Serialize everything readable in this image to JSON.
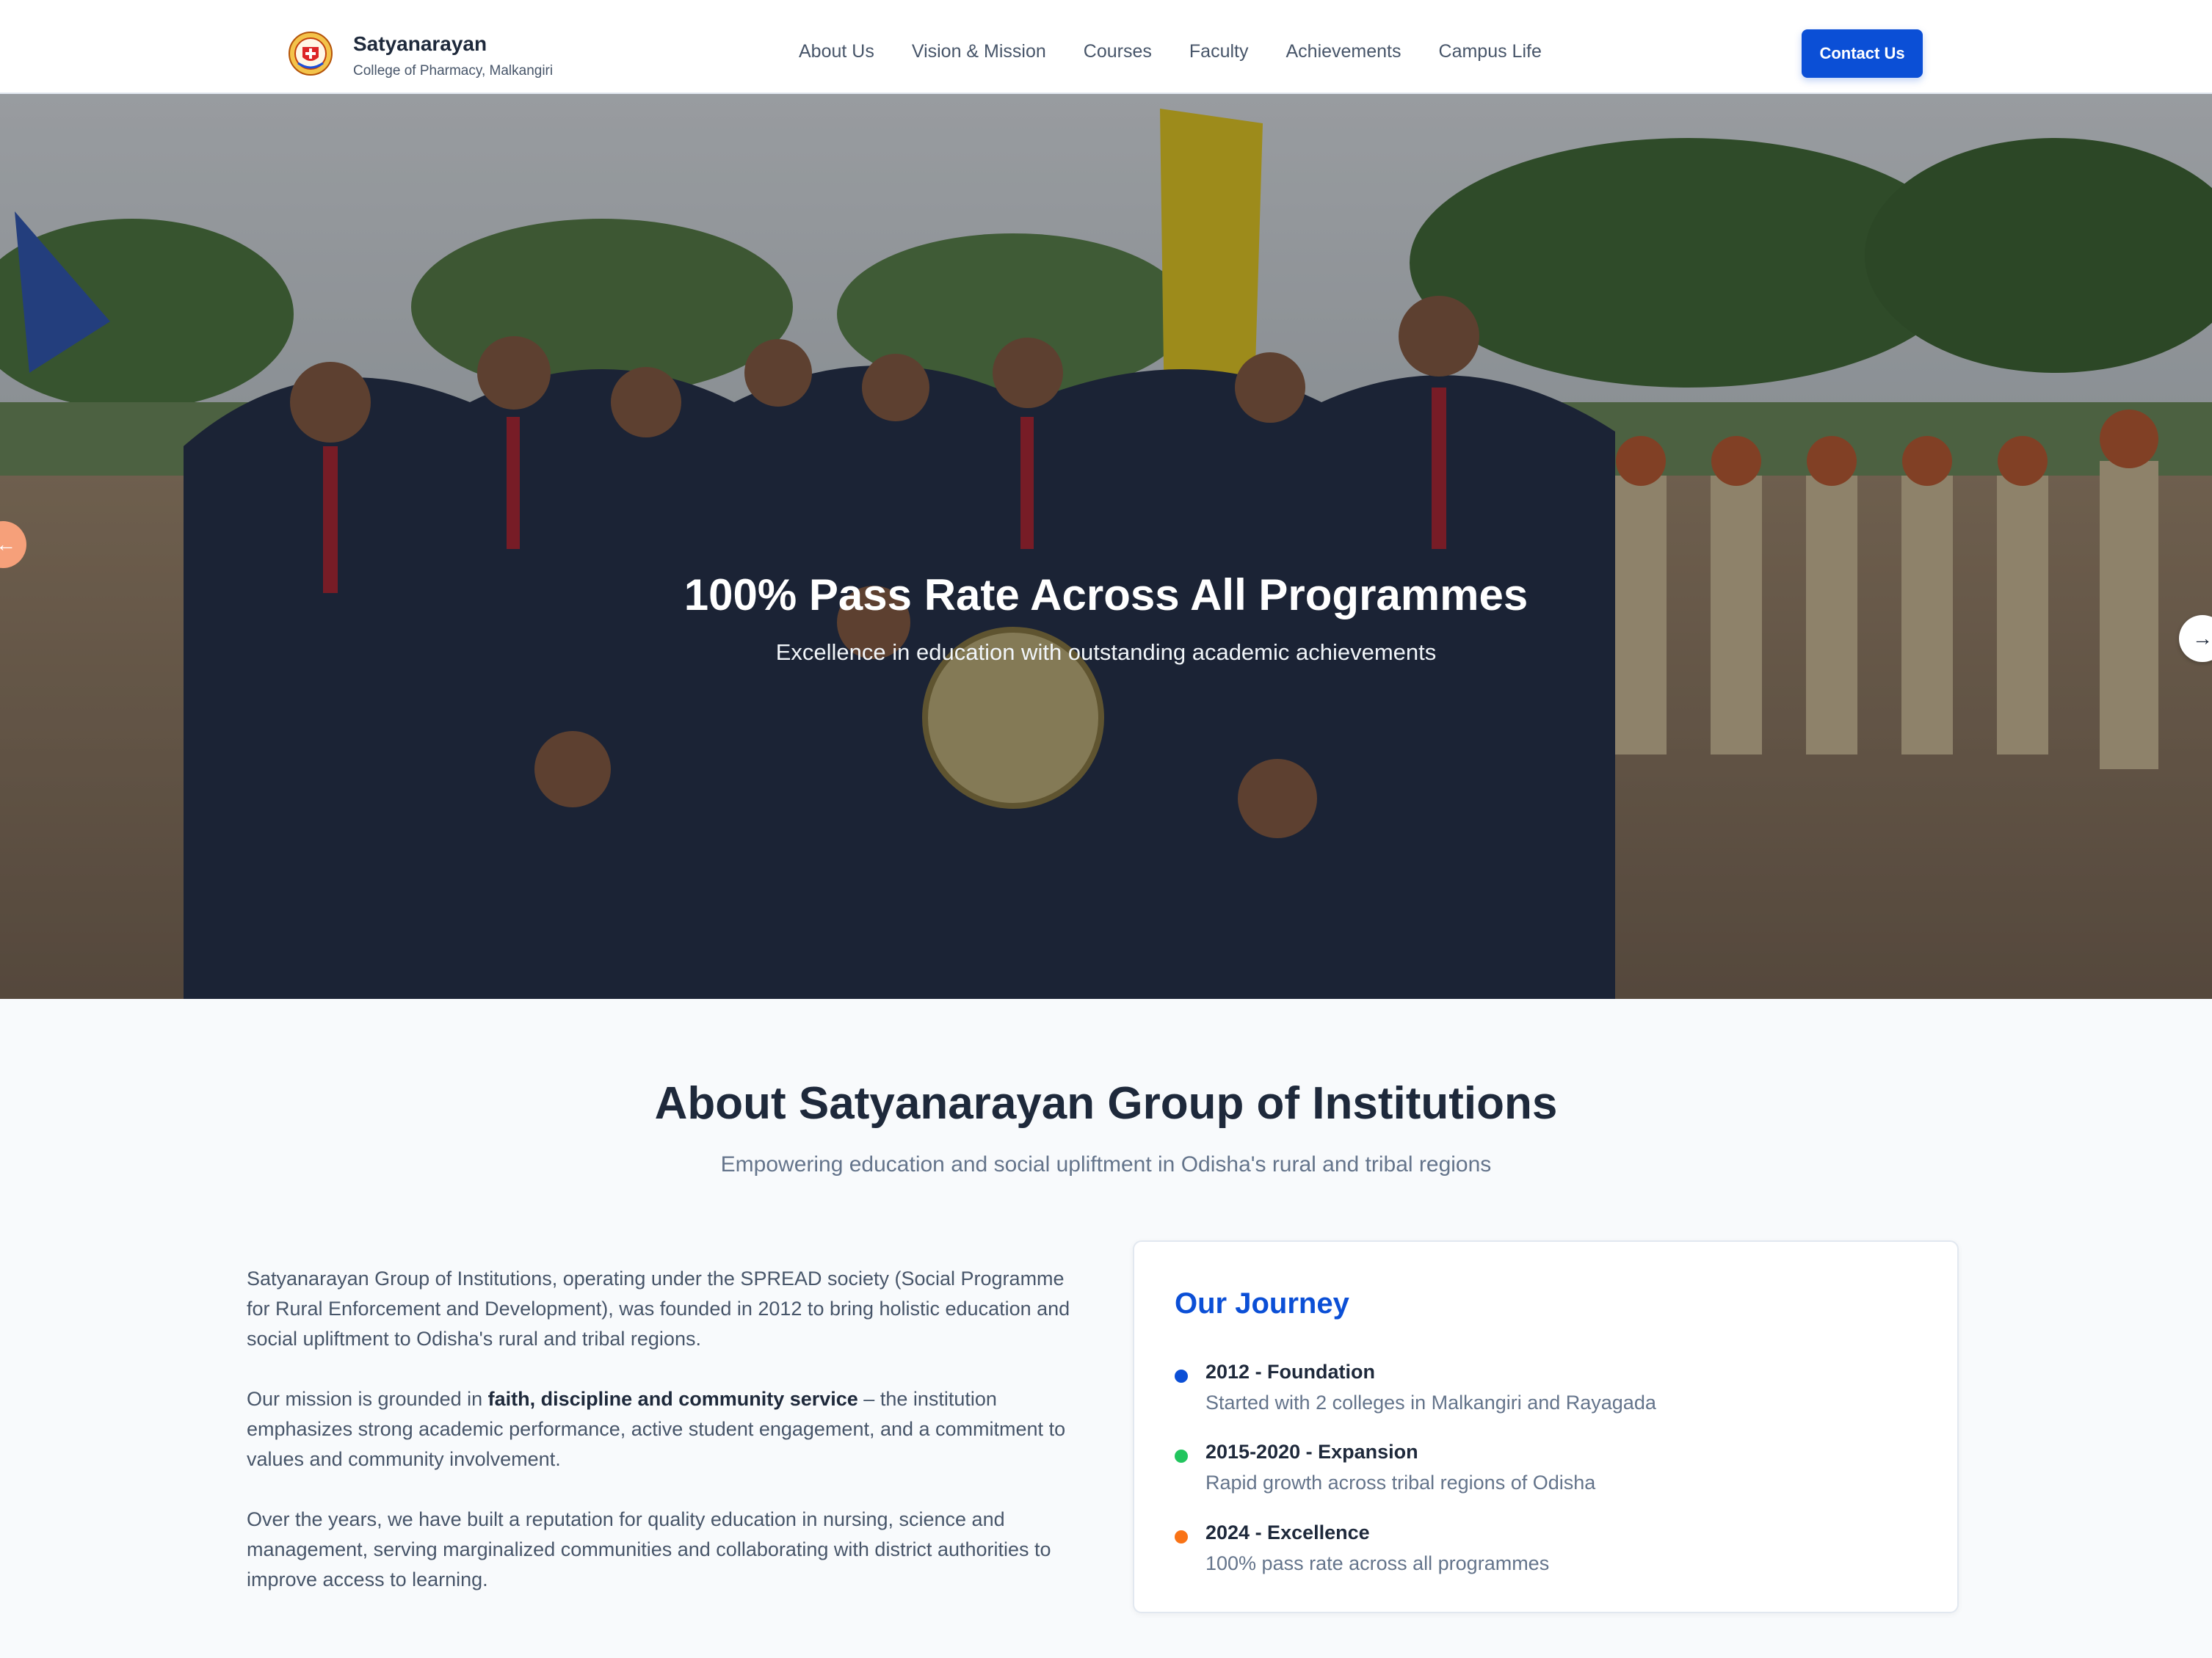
{
  "header": {
    "brand_name": "Satyanarayan",
    "brand_subtitle": "College of Pharmacy, Malkangiri",
    "nav_items": [
      {
        "label": "About Us"
      },
      {
        "label": "Vision & Mission"
      },
      {
        "label": "Courses"
      },
      {
        "label": "Faculty"
      },
      {
        "label": "Achievements"
      },
      {
        "label": "Campus Life"
      }
    ],
    "contact_label": "Contact Us",
    "accent_color": "#0b4fd6"
  },
  "hero": {
    "title": "100% Pass Rate Across All Programmes",
    "subtitle": "Excellence in education with outstanding academic achievements",
    "prev_icon": "arrow-left-icon",
    "next_icon": "arrow-right-icon"
  },
  "about": {
    "title": "About Satyanarayan Group of Institutions",
    "subtitle": "Empowering education and social upliftment in Odisha's rural and tribal regions",
    "para1": "Satyanarayan Group of Institutions, operating under the SPREAD society (Social Programme for Rural Enforcement and Development), was founded in 2012 to bring holistic education and social upliftment to Odisha's rural and tribal regions.",
    "para2_pre": "Our mission is grounded in ",
    "para2_bold": "faith, discipline and community service",
    "para2_post": " – the institution emphasizes strong academic performance, active student engagement, and a commitment to values and community involvement.",
    "para3": "Over the years, we have built a reputation for quality education in nursing, science and management, serving marginalized communities and collaborating with district authorities to improve access to learning."
  },
  "journey": {
    "title": "Our Journey",
    "items": [
      {
        "heading": "2012 - Foundation",
        "desc": "Started with 2 colleges in Malkangiri and Rayagada",
        "color": "#0b4fd6"
      },
      {
        "heading": "2015-2020 - Expansion",
        "desc": "Rapid growth across tribal regions of Odisha",
        "color": "#22c55e"
      },
      {
        "heading": "2024 - Excellence",
        "desc": "100% pass rate across all programmes",
        "color": "#f97316"
      }
    ]
  }
}
